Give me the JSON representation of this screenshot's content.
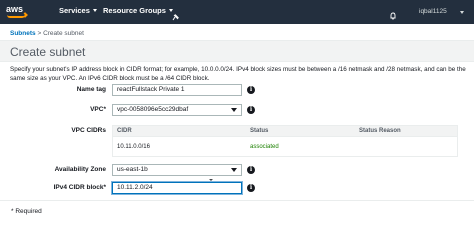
{
  "topnav": {
    "logo_text": "aws",
    "services_label": "Services",
    "resource_groups_label": "Resource Groups",
    "user_label": "iqbal1125"
  },
  "breadcrumb": {
    "parent": "Subnets",
    "separator": ">",
    "current": "Create subnet"
  },
  "page": {
    "title": "Create subnet",
    "description": "Specify your subnet's IP address block in CIDR format; for example, 10.0.0.0/24. IPv4 block sizes must be between a /16 netmask and /28 netmask, and can be the same size as your VPC. An IPv6 CIDR block must be a /64 CIDR block."
  },
  "form": {
    "name_tag_label": "Name tag",
    "name_tag_value": "reactFullstack Private 1",
    "vpc_label": "VPC*",
    "vpc_value": "vpc-0058096e5cc29dbaf",
    "vpc_cidrs_label": "VPC CIDRs",
    "cidr_table": {
      "col_cidr": "CIDR",
      "col_status": "Status",
      "col_reason": "Status Reason",
      "row_cidr": "10.11.0.0/16",
      "row_status": "associated",
      "row_reason": ""
    },
    "az_label": "Availability Zone",
    "az_value": "us-east-1b",
    "ipv4_label": "IPv4 CIDR block*",
    "ipv4_value": "10.11.2.0/24",
    "required_note": "* Required"
  },
  "icons": {
    "info": "i"
  },
  "colors": {
    "nav_bg": "#232f3e",
    "link": "#0073bb",
    "success": "#1d8102",
    "brand_orange": "#ff9900"
  }
}
